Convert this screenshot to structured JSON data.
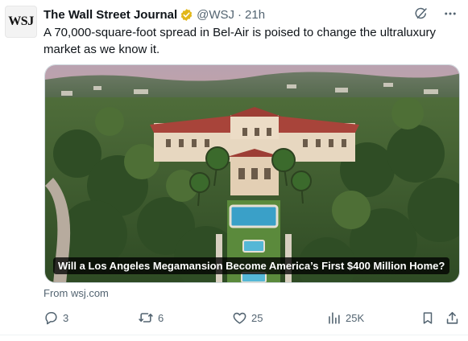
{
  "account": {
    "avatar_text": "WSJ",
    "name": "The Wall Street Journal",
    "handle": "@WSJ",
    "separator": "·",
    "time": "21h",
    "verified_color": "#e2b719"
  },
  "tweet": {
    "text": "A 70,000-square-foot spread in Bel-Air is poised to change the ultraluxury market as we know it."
  },
  "card": {
    "image_description_icon": "aerial-mansion-photo",
    "caption": "Will a Los Angeles Megamansion Become America’s First $400 Million Home?",
    "source": "From wsj.com"
  },
  "actions": {
    "replies": "3",
    "reposts": "6",
    "likes": "25",
    "views": "25K"
  },
  "colors": {
    "secondary_text": "#536471",
    "primary_text": "#0f1419"
  }
}
